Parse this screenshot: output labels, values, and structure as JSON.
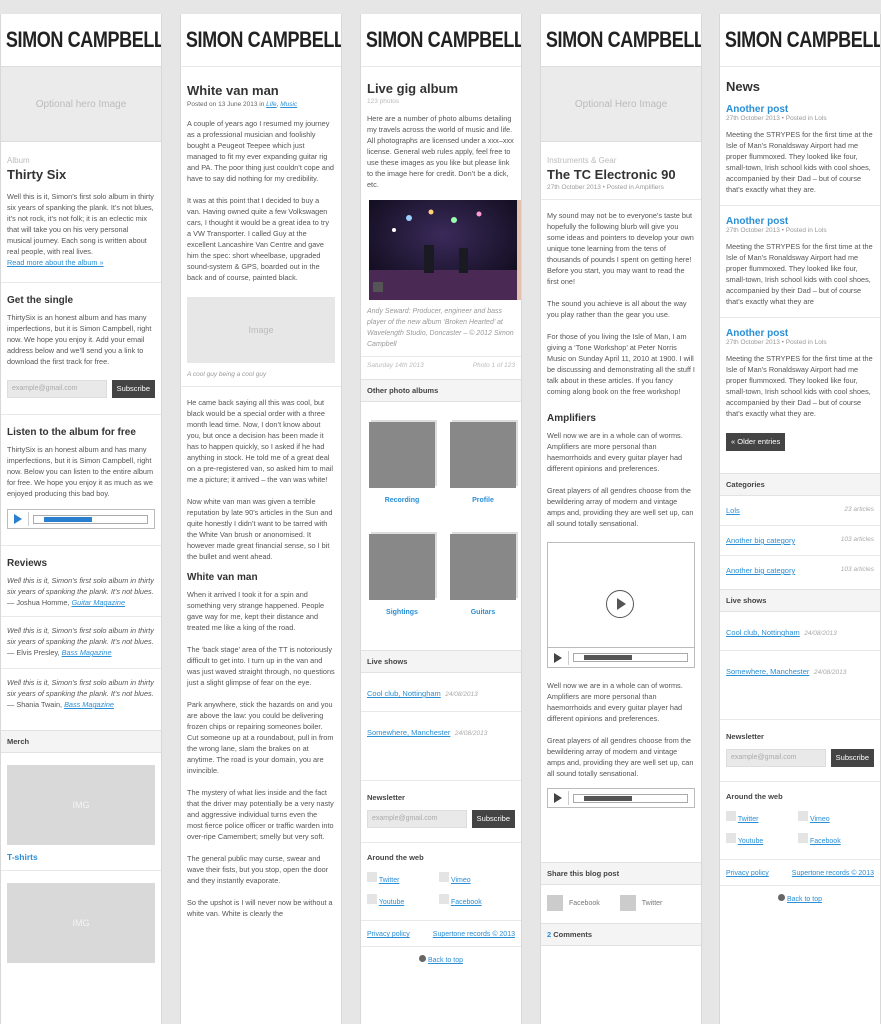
{
  "brand": "SIMON CAMPBELL",
  "col1": {
    "hero": "Optional hero Image",
    "kicker": "Album",
    "title": "Thirty Six",
    "intro": "Well this is it, Simon’s first solo album in thirty six years of spanking the plank. It’s not blues, it’s not rock, it’s not folk; it is an eclectic mix that will take you on his very personal musical journey. Each song is written about real people, with real lives.",
    "read_more": "Read more about the album »",
    "single_heading": "Get the single",
    "single_text": "ThirtySix is an honest album and has many imperfections, but it is Simon Campbell, right now. We hope you enjoy it. Add your email address below and we’ll send you a link to download the first track for free.",
    "email_placeholder": "example@gmail.com",
    "subscribe": "Subscribe",
    "listen_heading": "Listen to the album for free",
    "listen_text": "ThirtySix is an honest album and has many imperfections, but it is Simon Campbell, right now. Below you can listen to the entire album for free. We hope you enjoy it as much as we enjoyed producing this bad boy.",
    "reviews_heading": "Reviews",
    "reviews": [
      {
        "quote": "Well this is it, Simon’s first solo album in thirty six years of spanking the plank. It’s not blues.",
        "author": "— Joshua Homme,",
        "source": "Guitar Magazine"
      },
      {
        "quote": "Well this is it, Simon’s first solo album in thirty six years of spanking the plank. It’s not blues.",
        "author": "— Elvis Presley,",
        "source": "Bass Magazine"
      },
      {
        "quote": "Well this is it, Simon’s first solo album in thirty six years of spanking the plank. It’s not blues.",
        "author": "— Shania Twain,",
        "source": "Bass Magazine"
      }
    ],
    "merch_heading": "Merch",
    "img_label": "IMG",
    "tshirts": "T-shirts"
  },
  "col2": {
    "title": "White van man",
    "posted": "Posted on 13 June 2013 in",
    "cat1": "Life",
    "cat2": "Music",
    "p1": "A couple of years ago I resumed my journey as a professional musician and foolishly bought a Peugeot Teepee which just managed to fit my ever expanding guitar rig and PA. The poor thing just couldn’t cope and have to say did nothing for my credibility.",
    "p2": "It was at this point that I decided to buy a van. Having owned quite a few Volkswagen cars, I thought it would be a great idea to try a VW Transporter. I called Guy at the excellent Lancashire Van Centre and gave him the spec: short wheelbase, upgraded sound-system & GPS, boarded out in the back and of course, painted black.",
    "image": "Image",
    "caption": "A cool guy being a cool guy",
    "p3": "He came back saying all this was cool, but black would be a special order with a three month lead time. Now, I don’t know about you, but once a decision has been made it has to happen quickly, so I asked if he had anything in stock. He told me of a great deal on a pre-registered van, so asked him to mail me a picture; it arrived – the van was white!",
    "p4": "Now white van man was given a terrible reputation by late 90’s articles in the Sun and quite honestly I didn’t want to be tarred with the White Van brush or anonomised. It however made great financial sense, so I bit the bullet and went ahead.",
    "h2": "White van man",
    "p5": "When it arrived I took it for a spin and something very strange happened. People gave way for me, kept their distance and treated me like a king of the road.",
    "p6": "The ‘back stage’ area of the TT is notoriously difficult to get into. I turn up in the van and was just waved straight through, no questions just a slight glimpse of fear on the eye.",
    "p7": "Park anywhere, stick the hazards on and you are above the law: you could be delivering frozen chips or repairing someones boiler. Cut someone up at a roundabout, pull in from the wrong lane, slam the brakes on at anytime. The road is your domain, you are invincible.",
    "p8": "The mystery of what lies inside and the fact that the driver may potentially be a very nasty and aggressive individual turns even the most fierce police officer or traffic warden into over-ripe Camembert; smelly but very soft.",
    "p9": "The general public may curse, swear and wave their fists, but you stop, open the door and they instantly evaporate.",
    "p10": "So the upshot is I will never now be without a white van. White is clearly the"
  },
  "col3": {
    "title": "Live gig album",
    "count": "123 photos",
    "intro": "Here are a number of photo albums detailing my travels across the world of music and life. All photographs are licensed under a xxx–xxx license. General web rules apply, feel free to use these images as you like but please link to the image here for credit. Don’t be a dick, etc.",
    "photo_caption": "Andy Seward: Producer, engineer and bass player of the new album ‘Broken Hearted’ at Wavelength Studio, Doncaster – © 2012 Simon Campbell",
    "photo_date": "Saturday 14th 2013",
    "photo_num": "Photo 1 of 123",
    "other_heading": "Other photo albums",
    "albums": [
      "Recording",
      "Profile",
      "Sightings",
      "Guitars"
    ],
    "live_heading": "Live shows",
    "shows": [
      {
        "venue": "Cool club, Nottingham",
        "date": "24/08/2013"
      },
      {
        "venue": "Somewhere, Manchester",
        "date": "24/08/2013"
      }
    ],
    "newsletter": "Newsletter",
    "email_placeholder": "example@gmail.com",
    "subscribe": "Subscribe",
    "around": "Around the web",
    "social": [
      "Twitter",
      "Vimeo",
      "Youtube",
      "Facebook"
    ],
    "privacy": "Privacy policy",
    "records": "Supertone records © 2013",
    "back_top": "Back to top"
  },
  "col4": {
    "hero": "Optional Hero Image",
    "kicker": "Instruments & Gear",
    "title": "The TC Electronic 90",
    "meta": "27th October 2013 • Posted in Amplifiers",
    "p1": "My sound may not be to everyone’s taste but hopefully the following blurb will give you some ideas and pointers to develop your own unique tone learning from the tens of thousands of pounds I spent on getting here! Before you start, you may want to read the first one!",
    "p2": "The sound you achieve is all about the way you play rather than the gear you use.",
    "p3": "For those of you living the Isle of Man, I am giving a ‘Tone Workshop’ at Peter Norris Music on Sunday April 11, 2010 at 1900. I will be discussing and demonstrating all the stuff I talk about in these articles. If you fancy coming along book on the free workshop!",
    "h2": "Amplifiers",
    "p4": "Well now we are in a whole can of worms. Amplifiers are more personal than haemorrhoids and every guitar player had different opinions and preferences.",
    "p5": "Great players of all gendres choose from the bewildering array of modern and vintage amps and, providing they are well set up, can all sound totally sensational.",
    "p6": "Well now we are in a whole can of worms. Amplifiers are more personal than haemorrhoids and every guitar player had different opinions and preferences.",
    "p7": "Great players of all gendres choose from the bewildering array of modern and vintage amps and, providing they are well set up, can all sound totally sensational.",
    "share": "Share this blog post",
    "facebook": "Facebook",
    "twitter": "Twitter",
    "comments_num": "2",
    "comments": "Comments"
  },
  "col5": {
    "news": "News",
    "posts": [
      {
        "title": "Another post",
        "meta": "27th October 2013 • Posted in Lols",
        "text": "Meeting the STRYPES for the first time at the Isle of Man’s Ronaldsway Airport had me proper flummoxed. They looked like four, small-town, Irish school kids with cool shoes, accompanied by their Dad – but of course that’s exactly what they are."
      },
      {
        "title": "Another post",
        "meta": "27th October 2013 • Posted in Lols",
        "text": "Meeting the STRYPES for the first time at the Isle of Man’s Ronaldsway Airport had me proper flummoxed. They looked like four, small-town, Irish school kids with cool shoes, accompanied by their Dad – but of course that’s exactly what they are"
      },
      {
        "title": "Another post",
        "meta": "27th October 2013 • Posted in Lols",
        "text": "Meeting the STRYPES for the first time at the Isle of Man’s Ronaldsway Airport had me proper flummoxed. They looked like four, small-town, Irish school kids with cool shoes, accompanied by their Dad – but of course that’s exactly what they are."
      }
    ],
    "older": "« Older entries",
    "categories": "Categories",
    "cats": [
      {
        "name": "Lols",
        "count": "23 articles"
      },
      {
        "name": "Another big category",
        "count": "103 articles"
      },
      {
        "name": "Another big category",
        "count": "103 articles"
      }
    ],
    "live_heading": "Live shows",
    "shows": [
      {
        "venue": "Cool club, Nottingham",
        "date": "24/08/2013"
      },
      {
        "venue": "Somewhere, Manchester",
        "date": "24/08/2013"
      }
    ],
    "newsletter": "Newsletter",
    "email_placeholder": "example@gmail.com",
    "subscribe": "Subscribe",
    "around": "Around the web",
    "social": [
      "Twitter",
      "Vimeo",
      "Youtube",
      "Facebook"
    ],
    "privacy": "Privacy policy",
    "records": "Supertone records © 2013",
    "back_top": "Back to top"
  }
}
